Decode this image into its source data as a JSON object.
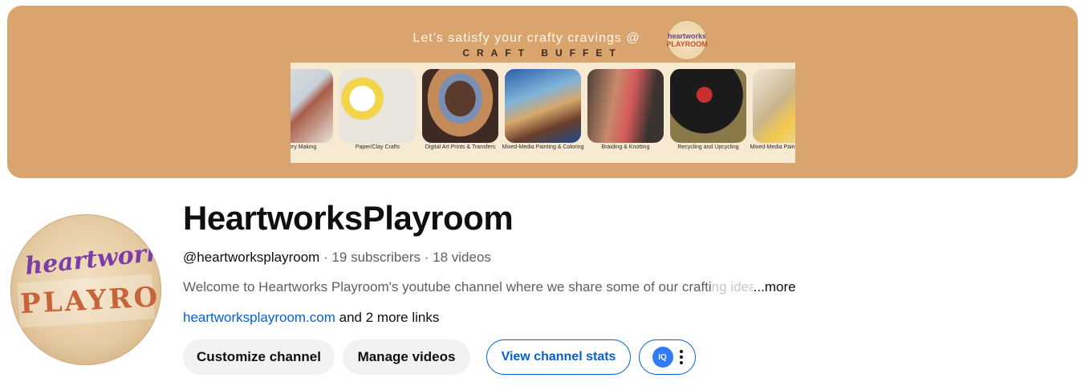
{
  "banner": {
    "tagline": "Let’s satisfy your crafty cravings @",
    "title": "CRAFT BUFFET",
    "logo_line1": "heartworks",
    "logo_line2": "PLAYROOM",
    "tiles": [
      {
        "label": "Jewellery Making",
        "icon": "jewellery-image"
      },
      {
        "label": "Paper/Clay Crafts",
        "icon": "clay-image"
      },
      {
        "label": "Digital Art Prints & Transfers",
        "icon": "digital-art-image"
      },
      {
        "label": "Mixed-Media Painting & Coloring",
        "icon": "ship-painting-image"
      },
      {
        "label": "Braiding & Knotting",
        "icon": "braiding-image"
      },
      {
        "label": "Recycling and Upcycling",
        "icon": "upcycling-image"
      },
      {
        "label": "Mixed-Media Painting & Coloring",
        "icon": "painting-image"
      }
    ],
    "color": "#d9a46e"
  },
  "channel": {
    "avatar_line1": "heartworks",
    "avatar_line2": "PLAYROOM",
    "name": "HeartworksPlayroom",
    "handle": "@heartworksplayroom",
    "subscribers": "19 subscribers",
    "videos": "18 videos",
    "description": "Welcome to Heartworks Playroom's youtube channel where we share some of our crafti",
    "description_fade": "ng ideas",
    "more_label": "...more",
    "link_text": "heartworksplayroom.com",
    "more_links": "and 2 more links"
  },
  "actions": {
    "customize": "Customize channel",
    "manage": "Manage videos",
    "stats": "View channel stats",
    "iq_icon_text": "IQ"
  },
  "colors": {
    "link": "#065fd4",
    "button_bg": "#f2f2f2",
    "iq_blue": "#2f7cf6"
  }
}
